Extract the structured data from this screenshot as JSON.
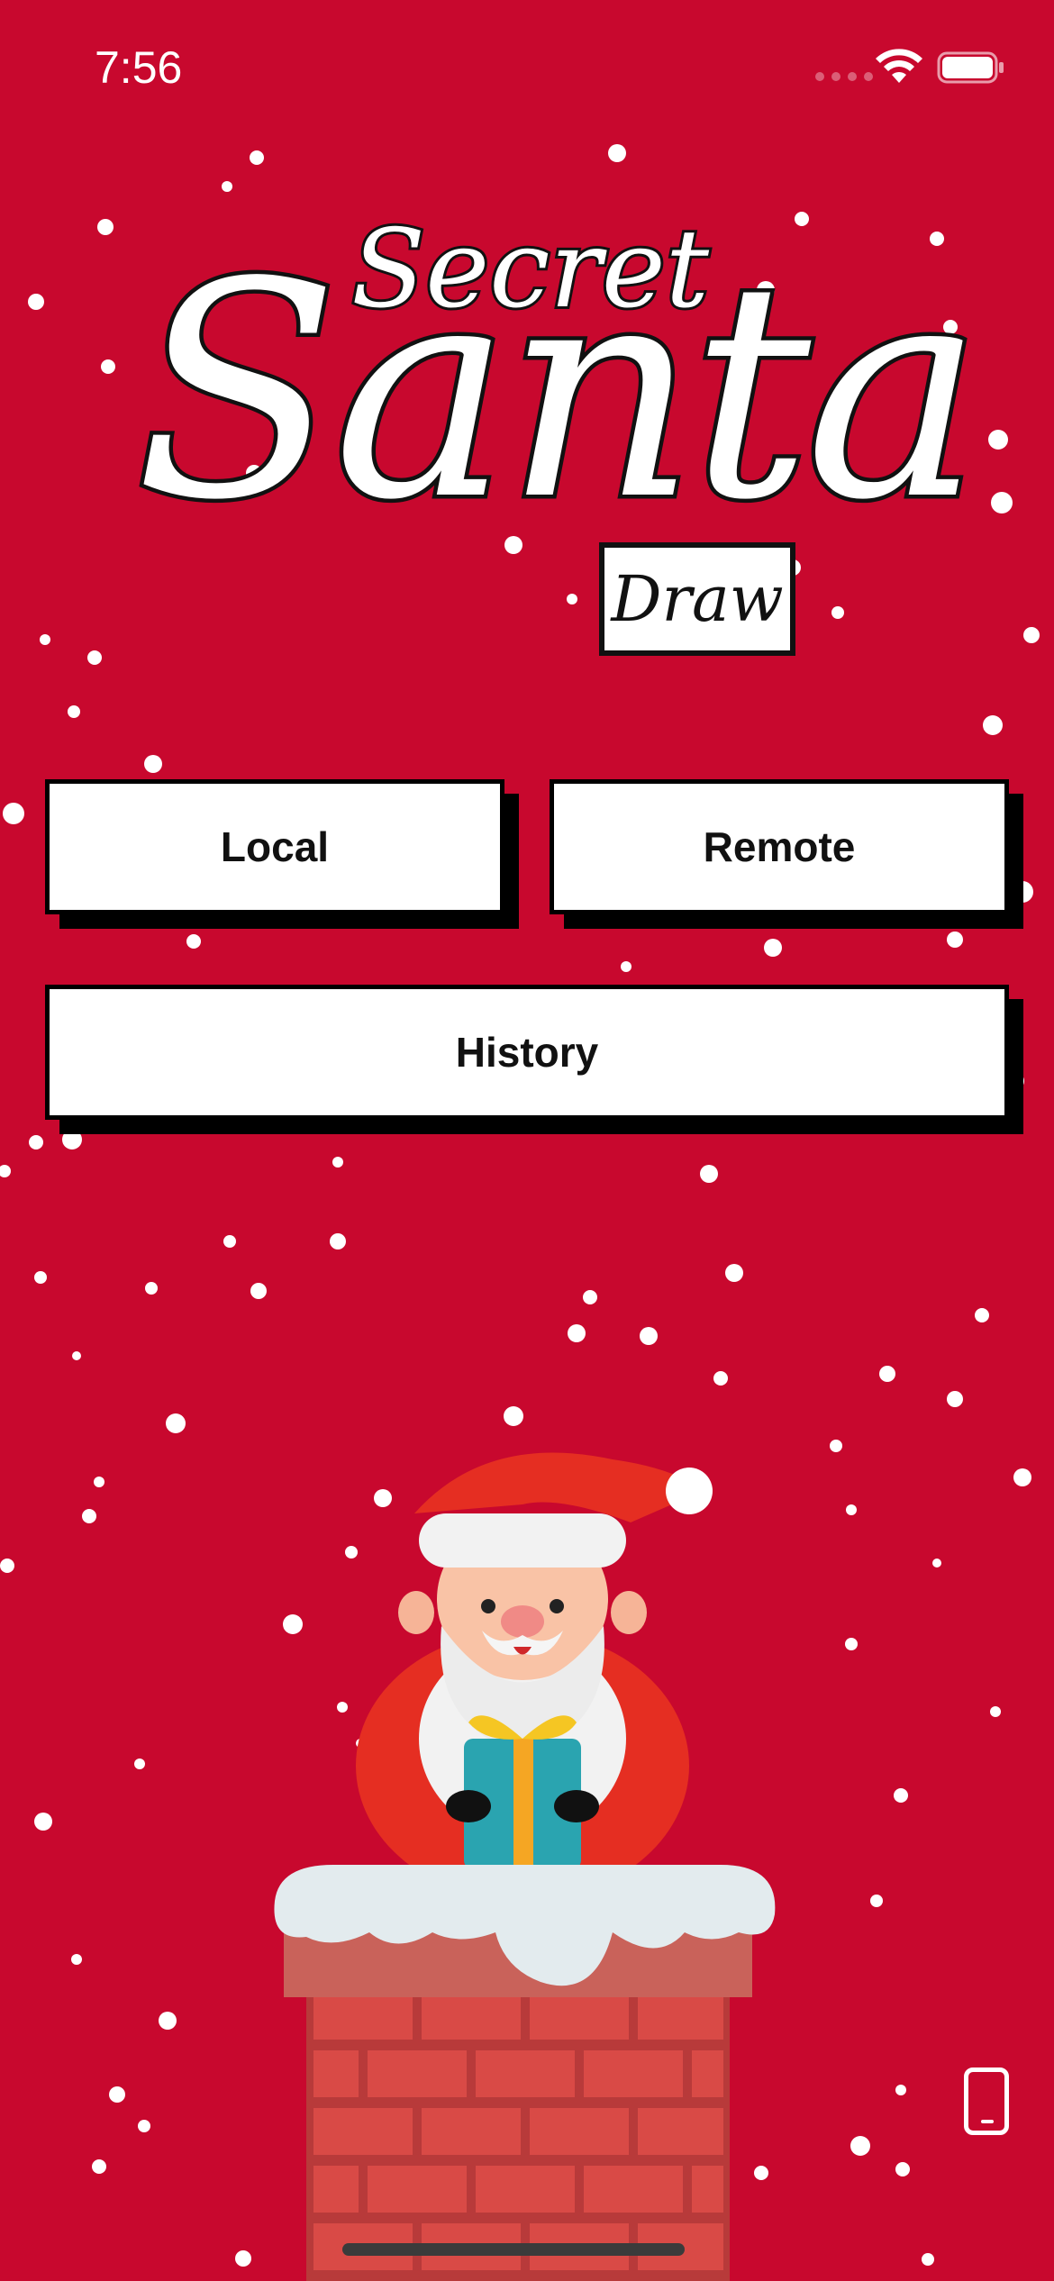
{
  "status_bar": {
    "time": "7:56"
  },
  "logo": {
    "secret": "Secret",
    "santa": "Santa",
    "draw": "Draw"
  },
  "buttons": {
    "local": "Local",
    "remote": "Remote",
    "history": "History"
  },
  "icons": {
    "wifi": "wifi-icon",
    "battery": "battery-icon",
    "device": "phone-icon"
  },
  "colors": {
    "background": "#c8082e",
    "button_fill": "#ffffff",
    "button_shadow": "#000000"
  }
}
